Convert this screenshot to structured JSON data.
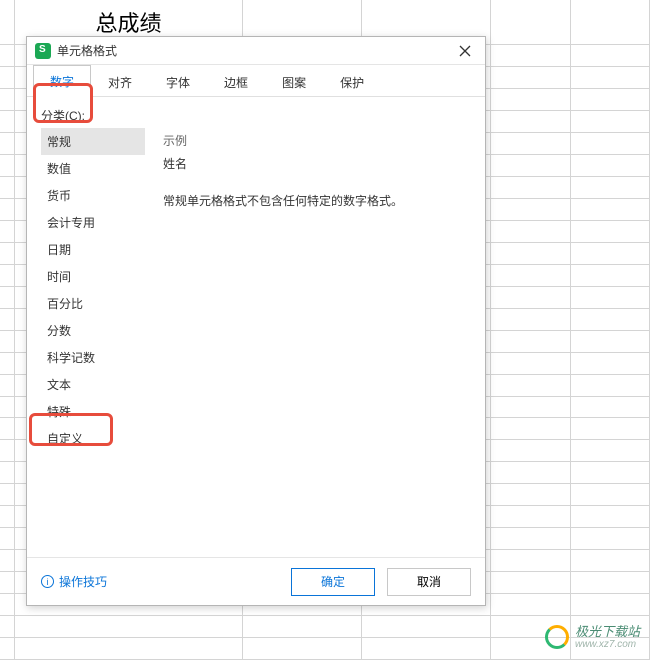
{
  "sheet": {
    "header_cell": "总成绩"
  },
  "dialog": {
    "title": "单元格格式",
    "tabs": [
      "数字",
      "对齐",
      "字体",
      "边框",
      "图案",
      "保护"
    ],
    "active_tab": 0,
    "category_label": "分类(C):",
    "categories": [
      "常规",
      "数值",
      "货币",
      "会计专用",
      "日期",
      "时间",
      "百分比",
      "分数",
      "科学记数",
      "文本",
      "特殊",
      "自定义"
    ],
    "selected_category": 0,
    "sample_label": "示例",
    "sample_value": "姓名",
    "description": "常规单元格格式不包含任何特定的数字格式。",
    "tips_text": "操作技巧",
    "ok_label": "确定",
    "cancel_label": "取消"
  },
  "watermark": {
    "name": "极光下载站",
    "url": "www.xz7.com"
  }
}
